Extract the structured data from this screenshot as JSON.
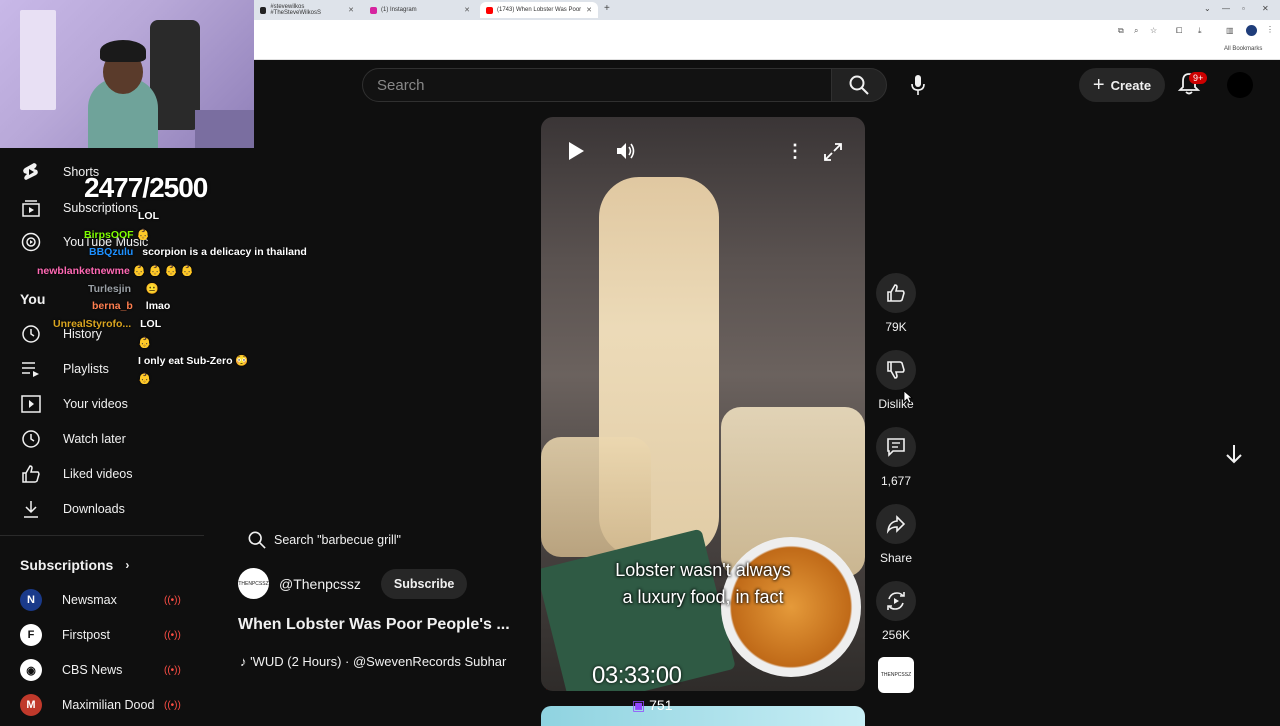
{
  "browser": {
    "tabs": [
      {
        "label": "#stevewilkos #TheSteveWilkosS",
        "active": false,
        "icon_color": "#222"
      },
      {
        "label": "(1) Instagram",
        "active": false,
        "icon_color": "#d6249f"
      },
      {
        "label": "(1743) When Lobster Was Poor",
        "active": true,
        "icon_color": "#ff0000"
      }
    ],
    "new_tab": "+",
    "bookmarks_label": "All Bookmarks"
  },
  "header": {
    "search_placeholder": "Search",
    "create_label": "Create",
    "notifications_badge": "9+"
  },
  "sidebar": {
    "items": [
      {
        "label": "Shorts",
        "icon": "shorts-icon"
      },
      {
        "label": "Subscriptions",
        "icon": "subscriptions-icon"
      },
      {
        "label": "YouTube Music",
        "icon": "music-icon"
      },
      {
        "label": "You",
        "icon": ""
      },
      {
        "label": "History",
        "icon": "history-icon"
      },
      {
        "label": "Playlists",
        "icon": "playlists-icon"
      },
      {
        "label": "Your videos",
        "icon": "your-videos-icon"
      },
      {
        "label": "Watch later",
        "icon": "clock-icon"
      },
      {
        "label": "Liked videos",
        "icon": "thumbs-up-icon"
      },
      {
        "label": "Downloads",
        "icon": "download-icon"
      }
    ],
    "subscriptions_heading": "Subscriptions",
    "subscriptions": [
      {
        "name": "Newsmax",
        "avatar_text": "N",
        "avatar_color": "#1a3a8a"
      },
      {
        "name": "Firstpost",
        "avatar_text": "F",
        "avatar_color": "#ffffff"
      },
      {
        "name": "CBS News",
        "avatar_text": "◉",
        "avatar_color": "#ffffff"
      },
      {
        "name": "Maximilian Dood",
        "avatar_text": "M",
        "avatar_color": "#c0392b"
      }
    ]
  },
  "overlay": {
    "goal": "2477/2500",
    "chat": [
      {
        "user": "",
        "user_color": "#8a2be2",
        "msg": "LOL"
      },
      {
        "user": "BirpsOOF",
        "user_color": "#7fff00",
        "msg": "👶"
      },
      {
        "user": "BBQzulu",
        "user_color": "#1e90ff",
        "msg": "scorpion is a delicacy in thailand"
      },
      {
        "user": "newblanketnewme",
        "user_color": "#ff69b4",
        "msg": "👶 👶 👶 👶"
      },
      {
        "user": "Turlesjin",
        "user_color": "#9aa0a6",
        "msg": "😐"
      },
      {
        "user": "berna_b",
        "user_color": "#ff7f50",
        "msg": "lmao"
      },
      {
        "user": "UnrealStyrofo...",
        "user_color": "#daa520",
        "msg": "LOL"
      },
      {
        "user": "",
        "user_color": "#1e90ff",
        "msg": "👶"
      },
      {
        "user": "",
        "user_color": "#0000cd",
        "msg": "I only eat Sub-Zero 😳"
      },
      {
        "user": "",
        "user_color": "#0000cd",
        "msg": "👶"
      }
    ],
    "timer": "03:33:00",
    "viewers": "751"
  },
  "short": {
    "caption_line1": "Lobster wasn't always",
    "caption_line2": "a luxury food, in fact",
    "search_suggestion": "Search \"barbecue grill\"",
    "channel": "@Thenpcssz",
    "channel_avatar_text": "THENPCSSZ",
    "subscribe_label": "Subscribe",
    "title": "When Lobster Was Poor People's ...",
    "music": "♪ 'WUD (2 Hours) · @SwevenRecords   Subhar"
  },
  "actions": {
    "like_count": "79K",
    "dislike_label": "Dislike",
    "comments_count": "1,677",
    "share_label": "Share",
    "remix_count": "256K"
  },
  "colors": {
    "background": "#0f0f0f",
    "button_bg": "#272727",
    "live_red": "#ff4e45",
    "badge_red": "#cc0000"
  }
}
